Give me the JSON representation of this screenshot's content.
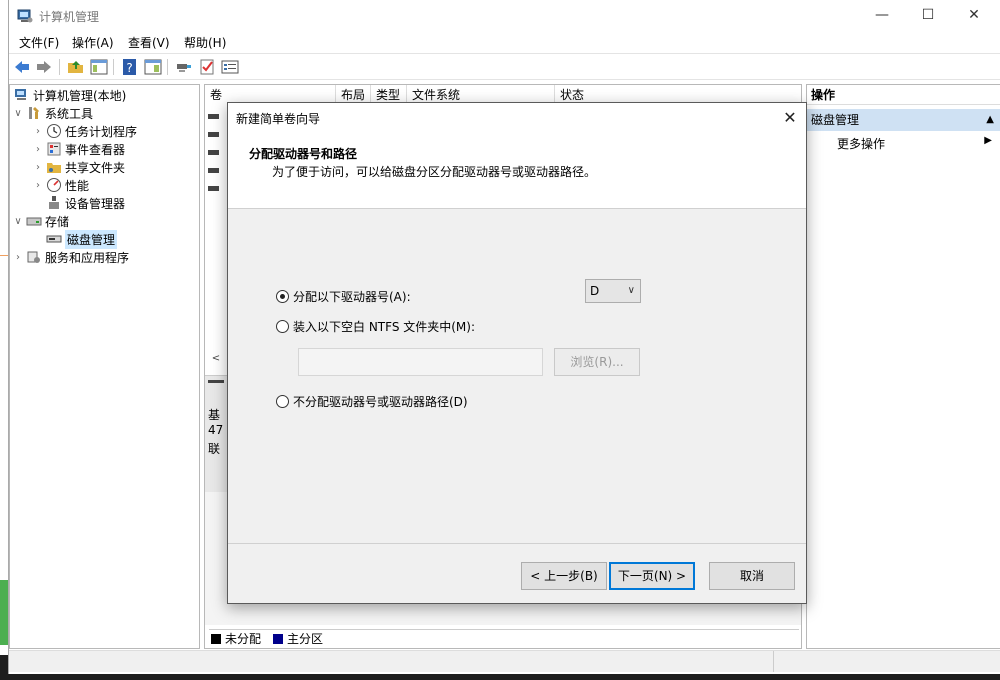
{
  "window": {
    "title": "计算机管理"
  },
  "menu": [
    "文件(F)",
    "操作(A)",
    "查看(V)",
    "帮助(H)"
  ],
  "tree": {
    "root": "计算机管理(本地)",
    "items": [
      {
        "label": "系统工具",
        "level": 1,
        "expanded": true
      },
      {
        "label": "任务计划程序",
        "level": 2
      },
      {
        "label": "事件查看器",
        "level": 2
      },
      {
        "label": "共享文件夹",
        "level": 2
      },
      {
        "label": "性能",
        "level": 2
      },
      {
        "label": "设备管理器",
        "level": 2
      },
      {
        "label": "存储",
        "level": 1,
        "expanded": true
      },
      {
        "label": "磁盘管理",
        "level": 2,
        "selected": true
      },
      {
        "label": "服务和应用程序",
        "level": 1
      }
    ]
  },
  "center": {
    "columns": [
      "卷",
      "布局",
      "类型",
      "文件系统",
      "状态"
    ],
    "disk_label_lines": [
      "基",
      "47",
      "联"
    ],
    "legend": [
      {
        "label": "未分配",
        "color": "#000000"
      },
      {
        "label": "主分区",
        "color": "#00008b"
      }
    ]
  },
  "actions": {
    "header": "操作",
    "section": "磁盘管理",
    "more": "更多操作"
  },
  "dialog": {
    "title": "新建简单卷向导",
    "heading": "分配驱动器号和路径",
    "subheading": "为了便于访问，可以给磁盘分区分配驱动器号或驱动器路径。",
    "option_assign": "分配以下驱动器号(A):",
    "option_assign_key": "A",
    "option_mount": "装入以下空白 NTFS 文件夹中(M):",
    "option_none": "不分配驱动器号或驱动器路径(D)",
    "drive_letter": "D",
    "browse_label": "浏览(R)...",
    "back_label": "< 上一步(B)",
    "next_label": "下一页(N) >",
    "cancel_label": "取消",
    "selected_option": "assign"
  }
}
